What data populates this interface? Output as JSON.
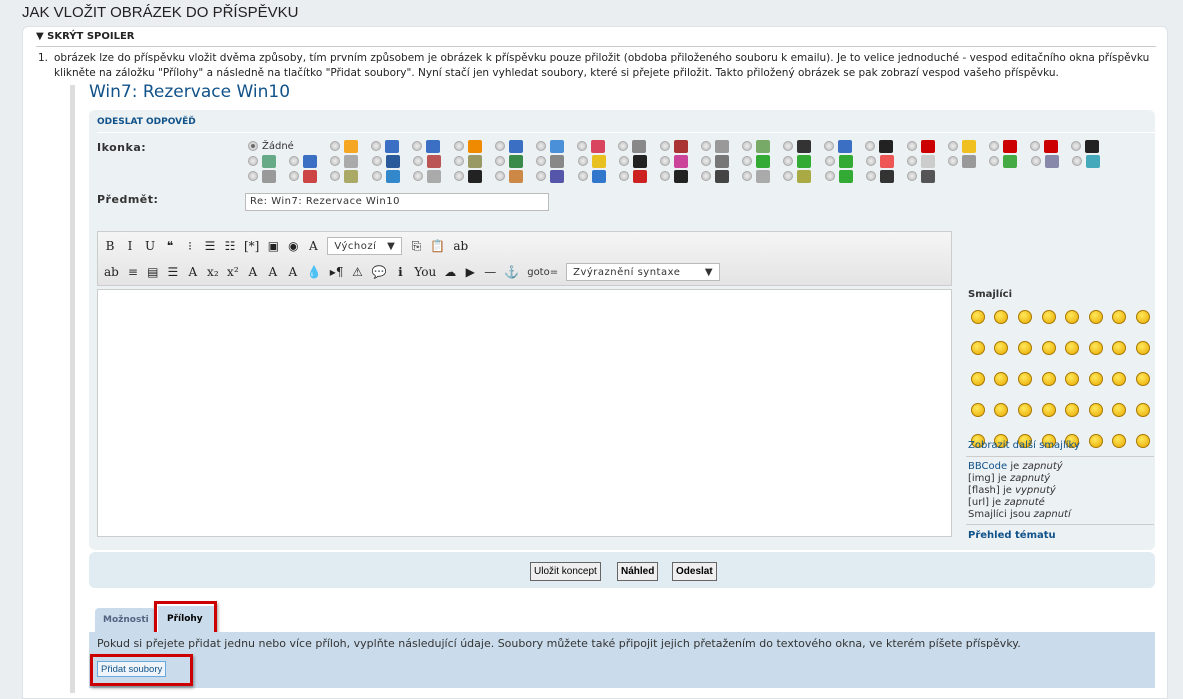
{
  "page_title": "JAK VLOŽIT OBRÁZEK DO PŘÍSPĚVKU",
  "spoiler_label": "▼ SKRÝT SPOILER",
  "intro": {
    "number": "1.",
    "text": "obrázek lze do příspěvku vložit dvěma způsoby, tím prvním způsobem je obrázek k příspěvku pouze přiložit (obdoba přiloženého souboru k emailu). Je to velice jednoduché - vespod editačního okna příspěvku klikněte na záložku \"Přílohy\" a následně na tlačítko \"Přidat soubory\". Nyní stačí jen vyhledat soubory, které si přejete přiložit. Takto přiložený obrázek se pak zobrazí vespod vašeho příspěvku."
  },
  "post_title": "Win7: Rezervace Win10",
  "form": {
    "heading": "ODESLAT ODPOVĚĎ",
    "icon_label": "Ikonka:",
    "icon_none": "Žádné",
    "icons": [
      "#f5a623",
      "#3b6fc4",
      "#3b6fc4",
      "#f08a00",
      "#3b6fc4",
      "#4a90d9",
      "#d9455f",
      "#888",
      "#a33",
      "#999",
      "#7a6",
      "#333",
      "#3a6fc4",
      "#222",
      "#c00",
      "#f0c020",
      "#c00",
      "#c00",
      "#222",
      "#6a8",
      "#3a6fc4",
      "#aaa",
      "#2a5a9a",
      "#b55",
      "#996",
      "#3a8a4a",
      "#888",
      "#e8c020",
      "#222",
      "#c49",
      "#777",
      "#3a3",
      "#3a3",
      "#3a3",
      "#e55",
      "#ccc",
      "#999",
      "#4a4",
      "#88a",
      "#4ab",
      "#999",
      "#c44",
      "#aa6",
      "#38c",
      "#aaa",
      "#222",
      "#c84",
      "#55a",
      "#37c",
      "#c22",
      "#222",
      "#444",
      "#aaa",
      "#aa4",
      "#3a3",
      "#333",
      "#555"
    ],
    "subject_label": "Předmět:",
    "subject_value": "Re: Win7: Rezervace Win10",
    "toolbar_row1": [
      "B",
      "I",
      "U",
      "❝",
      "⁝",
      "☰",
      "☷",
      "[*]",
      "▣",
      "◉",
      "A"
    ],
    "font_select": "Výchozí",
    "toolbar_row1b": [
      "⎘",
      "📋",
      "ab"
    ],
    "toolbar_row2": [
      "ab",
      "≡",
      "▤",
      "☰",
      "A",
      "x₂",
      "x²",
      "A",
      "A",
      "A",
      "💧",
      "▸¶",
      "⚠",
      "💬",
      "ℹ",
      "You",
      "☁",
      "▶",
      "—",
      "⚓"
    ],
    "goto_label": "goto=",
    "syntax_select": "Zvýraznění syntaxe",
    "smileys_heading": "Smajlíci",
    "smiley_count": 40,
    "more_smileys": "Zobrazit další smajlíky",
    "status": {
      "bbcode": "BBCode",
      "bbcode_rest": " je ",
      "bbcode_state": "zapnutý",
      "img": "[img] je ",
      "img_state": "zapnutý",
      "flash": "[flash] je ",
      "flash_state": "vypnutý",
      "url": "[url] je ",
      "url_state": "zapnuté",
      "smileys": "Smajlíci jsou ",
      "smileys_state": "zapnutí"
    },
    "topic_review": "Přehled tématu",
    "save_draft": "Uložit koncept",
    "preview": "Náhled",
    "submit": "Odeslat"
  },
  "tabs": {
    "options": "Možnosti",
    "attachments": "Přílohy"
  },
  "attachments": {
    "text": "Pokud si přejete přidat jednu nebo více příloh, vyplňte následující údaje. Soubory můžete také připojit jejich přetažením do textového okna, ve kterém píšete příspěvky.",
    "add_files": "Přidat soubory"
  },
  "highlight_color": "#cc0000"
}
